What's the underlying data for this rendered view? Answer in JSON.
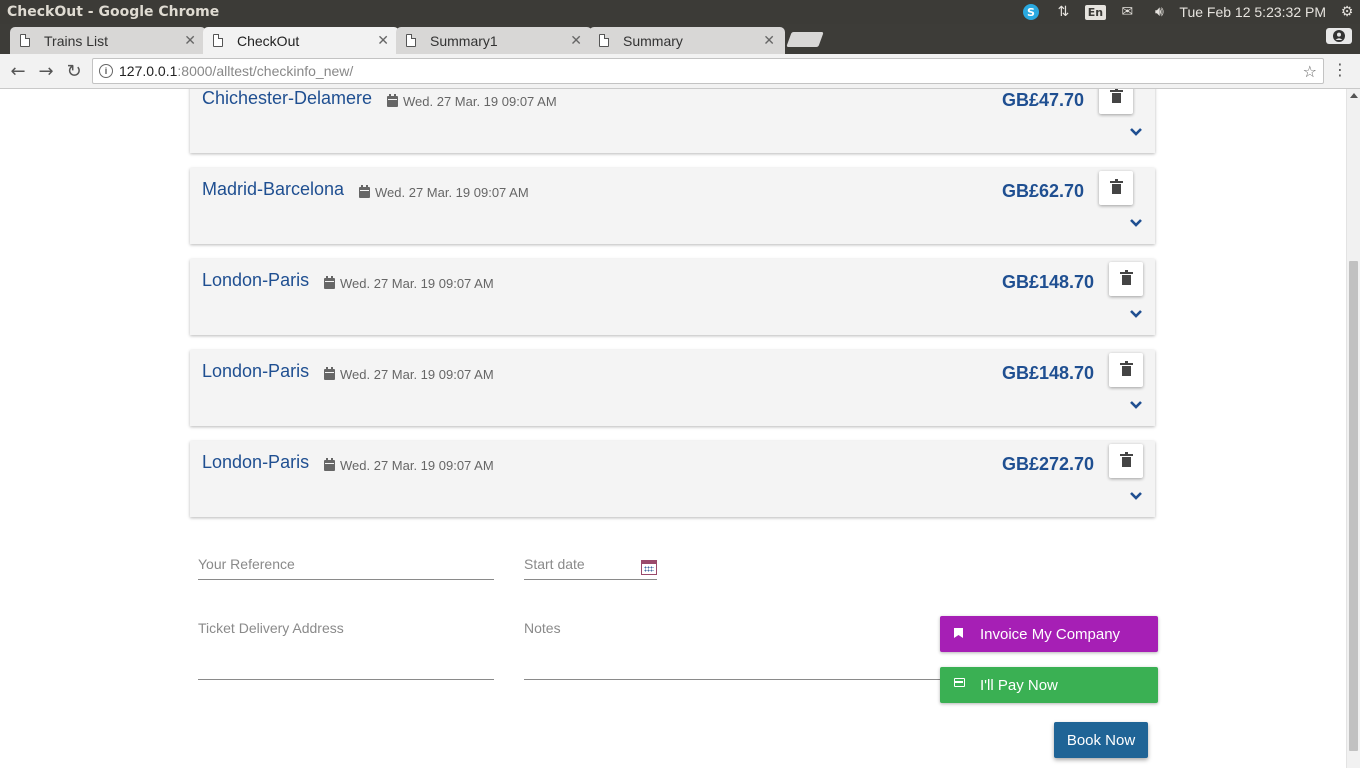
{
  "os": {
    "window_title": "CheckOut - Google Chrome",
    "keyboard_layout": "En",
    "clock": "Tue Feb 12  5:23:32 PM"
  },
  "browser": {
    "tabs": [
      {
        "label": "Trains List",
        "active": false
      },
      {
        "label": "CheckOut",
        "active": true
      },
      {
        "label": "Summary1",
        "active": false
      },
      {
        "label": "Summary",
        "active": false
      }
    ],
    "url_host": "127.0.0.1",
    "url_path": ":8000/alltest/checkinfo_new/"
  },
  "journeys": [
    {
      "route": "Chichester-Delamere",
      "date": "Wed. 27 Mar. 19 09:07 AM",
      "price": "GB£47.70"
    },
    {
      "route": "Madrid-Barcelona",
      "date": "Wed. 27 Mar. 19 09:07 AM",
      "price": "GB£62.70"
    },
    {
      "route": "London-Paris",
      "date": "Wed. 27 Mar. 19 09:07 AM",
      "price": "GB£148.70"
    },
    {
      "route": "London-Paris",
      "date": "Wed. 27 Mar. 19 09:07 AM",
      "price": "GB£148.70"
    },
    {
      "route": "London-Paris",
      "date": "Wed. 27 Mar. 19 09:07 AM",
      "price": "GB£272.70"
    }
  ],
  "form": {
    "reference_placeholder": "Your Reference",
    "start_date_placeholder": "Start date",
    "delivery_address_placeholder": "Ticket Delivery Address",
    "notes_placeholder": "Notes"
  },
  "actions": {
    "invoice_label": "Invoice My Company",
    "invoice_color": "#a61fb5",
    "pay_now_label": "I'll Pay Now",
    "pay_now_color": "#3ab053",
    "book_label": "Book Now"
  },
  "colors": {
    "accent": "#1f4f91",
    "book_button": "#1f6496"
  }
}
